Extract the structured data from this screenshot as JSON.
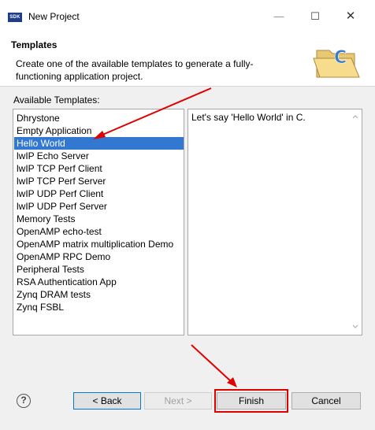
{
  "window": {
    "app_icon_text": "SDK",
    "title": "New Project",
    "minimize_glyph": "—",
    "maximize_glyph": "☐",
    "close_glyph": "✕"
  },
  "header": {
    "title": "Templates",
    "description": "Create one of the available templates to generate a fully-functioning application project."
  },
  "templates": {
    "label": "Available Templates:",
    "selected_index": 2,
    "items": [
      "Dhrystone",
      "Empty Application",
      "Hello World",
      "lwIP Echo Server",
      "lwIP TCP Perf Client",
      "lwIP TCP Perf Server",
      "lwIP UDP Perf Client",
      "lwIP UDP Perf Server",
      "Memory Tests",
      "OpenAMP echo-test",
      "OpenAMP matrix multiplication Demo",
      "OpenAMP RPC Demo",
      "Peripheral Tests",
      "RSA Authentication App",
      "Zynq DRAM tests",
      "Zynq FSBL"
    ],
    "description": "Let's say 'Hello World' in C."
  },
  "footer": {
    "help_glyph": "?",
    "back_label": "< Back",
    "next_label": "Next >",
    "finish_label": "Finish",
    "cancel_label": "Cancel"
  },
  "colors": {
    "selection": "#3278d0",
    "annotation": "#e00000",
    "accent_border": "#0078d7"
  },
  "icons": [
    "sdk-app-icon",
    "folder-c-icon",
    "help-icon",
    "scroll-up-icon",
    "scroll-down-icon"
  ]
}
